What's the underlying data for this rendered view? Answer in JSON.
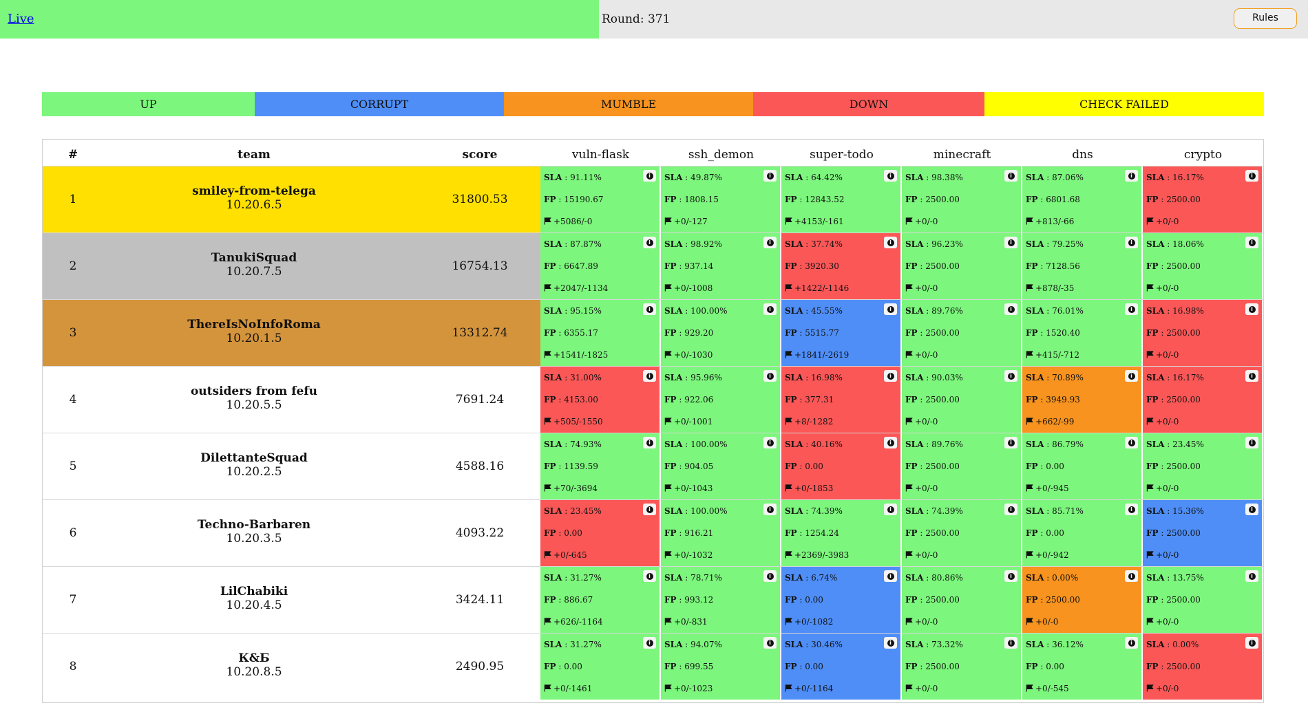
{
  "header": {
    "live_label": "Live",
    "round_label": "Round: 371",
    "rules_label": "Rules"
  },
  "colors": {
    "up": "#7cf67c",
    "corrupt": "#4f8ef7",
    "mumble": "#f7931e",
    "down": "#fb5757",
    "check_failed": "#ffff00",
    "gold": "#ffe000",
    "silver": "#c0c0c0",
    "bronze": "#d4943c"
  },
  "legend": [
    {
      "label": "UP",
      "status": "up"
    },
    {
      "label": "CORRUPT",
      "status": "corrupt"
    },
    {
      "label": "MUMBLE",
      "status": "mumble"
    },
    {
      "label": "DOWN",
      "status": "down"
    },
    {
      "label": "CHECK FAILED",
      "status": "check_failed"
    }
  ],
  "table": {
    "columns": {
      "rank": "#",
      "team": "team",
      "score": "score"
    },
    "services": [
      "vuln-flask",
      "ssh_demon",
      "super-todo",
      "minecraft",
      "dns",
      "crypto"
    ],
    "rows": [
      {
        "rank": "1",
        "name": "smiley-from-telega",
        "ip": "10.20.6.5",
        "score": "31800.53",
        "highlight": "gold",
        "cells": [
          {
            "status": "up",
            "sla": "91.11%",
            "fp": "15190.67",
            "flags": "+5086/-0"
          },
          {
            "status": "up",
            "sla": "49.87%",
            "fp": "1808.15",
            "flags": "+0/-127"
          },
          {
            "status": "up",
            "sla": "64.42%",
            "fp": "12843.52",
            "flags": "+4153/-161"
          },
          {
            "status": "up",
            "sla": "98.38%",
            "fp": "2500.00",
            "flags": "+0/-0"
          },
          {
            "status": "up",
            "sla": "87.06%",
            "fp": "6801.68",
            "flags": "+813/-66"
          },
          {
            "status": "down",
            "sla": "16.17%",
            "fp": "2500.00",
            "flags": "+0/-0"
          }
        ]
      },
      {
        "rank": "2",
        "name": "TanukiSquad",
        "ip": "10.20.7.5",
        "score": "16754.13",
        "highlight": "silver",
        "cells": [
          {
            "status": "up",
            "sla": "87.87%",
            "fp": "6647.89",
            "flags": "+2047/-1134"
          },
          {
            "status": "up",
            "sla": "98.92%",
            "fp": "937.14",
            "flags": "+0/-1008"
          },
          {
            "status": "down",
            "sla": "37.74%",
            "fp": "3920.30",
            "flags": "+1422/-1146"
          },
          {
            "status": "up",
            "sla": "96.23%",
            "fp": "2500.00",
            "flags": "+0/-0"
          },
          {
            "status": "up",
            "sla": "79.25%",
            "fp": "7128.56",
            "flags": "+878/-35"
          },
          {
            "status": "up",
            "sla": "18.06%",
            "fp": "2500.00",
            "flags": "+0/-0"
          }
        ]
      },
      {
        "rank": "3",
        "name": "ThereIsNoInfoRoma",
        "ip": "10.20.1.5",
        "score": "13312.74",
        "highlight": "bronze",
        "cells": [
          {
            "status": "up",
            "sla": "95.15%",
            "fp": "6355.17",
            "flags": "+1541/-1825"
          },
          {
            "status": "up",
            "sla": "100.00%",
            "fp": "929.20",
            "flags": "+0/-1030"
          },
          {
            "status": "corrupt",
            "sla": "45.55%",
            "fp": "5515.77",
            "flags": "+1841/-2619"
          },
          {
            "status": "up",
            "sla": "89.76%",
            "fp": "2500.00",
            "flags": "+0/-0"
          },
          {
            "status": "up",
            "sla": "76.01%",
            "fp": "1520.40",
            "flags": "+415/-712"
          },
          {
            "status": "down",
            "sla": "16.98%",
            "fp": "2500.00",
            "flags": "+0/-0"
          }
        ]
      },
      {
        "rank": "4",
        "name": "outsiders from fefu",
        "ip": "10.20.5.5",
        "score": "7691.24",
        "highlight": "none",
        "cells": [
          {
            "status": "down",
            "sla": "31.00%",
            "fp": "4153.00",
            "flags": "+505/-1550"
          },
          {
            "status": "up",
            "sla": "95.96%",
            "fp": "922.06",
            "flags": "+0/-1001"
          },
          {
            "status": "down",
            "sla": "16.98%",
            "fp": "377.31",
            "flags": "+8/-1282"
          },
          {
            "status": "up",
            "sla": "90.03%",
            "fp": "2500.00",
            "flags": "+0/-0"
          },
          {
            "status": "mumble",
            "sla": "70.89%",
            "fp": "3949.93",
            "flags": "+662/-99"
          },
          {
            "status": "down",
            "sla": "16.17%",
            "fp": "2500.00",
            "flags": "+0/-0"
          }
        ]
      },
      {
        "rank": "5",
        "name": "DilettanteSquad",
        "ip": "10.20.2.5",
        "score": "4588.16",
        "highlight": "none",
        "cells": [
          {
            "status": "up",
            "sla": "74.93%",
            "fp": "1139.59",
            "flags": "+70/-3694"
          },
          {
            "status": "up",
            "sla": "100.00%",
            "fp": "904.05",
            "flags": "+0/-1043"
          },
          {
            "status": "down",
            "sla": "40.16%",
            "fp": "0.00",
            "flags": "+0/-1853"
          },
          {
            "status": "up",
            "sla": "89.76%",
            "fp": "2500.00",
            "flags": "+0/-0"
          },
          {
            "status": "up",
            "sla": "86.79%",
            "fp": "0.00",
            "flags": "+0/-945"
          },
          {
            "status": "up",
            "sla": "23.45%",
            "fp": "2500.00",
            "flags": "+0/-0"
          }
        ]
      },
      {
        "rank": "6",
        "name": "Techno-Barbaren",
        "ip": "10.20.3.5",
        "score": "4093.22",
        "highlight": "none",
        "cells": [
          {
            "status": "down",
            "sla": "23.45%",
            "fp": "0.00",
            "flags": "+0/-645"
          },
          {
            "status": "up",
            "sla": "100.00%",
            "fp": "916.21",
            "flags": "+0/-1032"
          },
          {
            "status": "up",
            "sla": "74.39%",
            "fp": "1254.24",
            "flags": "+2369/-3983"
          },
          {
            "status": "up",
            "sla": "74.39%",
            "fp": "2500.00",
            "flags": "+0/-0"
          },
          {
            "status": "up",
            "sla": "85.71%",
            "fp": "0.00",
            "flags": "+0/-942"
          },
          {
            "status": "corrupt",
            "sla": "15.36%",
            "fp": "2500.00",
            "flags": "+0/-0"
          }
        ]
      },
      {
        "rank": "7",
        "name": "LilChabiki",
        "ip": "10.20.4.5",
        "score": "3424.11",
        "highlight": "none",
        "cells": [
          {
            "status": "up",
            "sla": "31.27%",
            "fp": "886.67",
            "flags": "+626/-1164"
          },
          {
            "status": "up",
            "sla": "78.71%",
            "fp": "993.12",
            "flags": "+0/-831"
          },
          {
            "status": "corrupt",
            "sla": "6.74%",
            "fp": "0.00",
            "flags": "+0/-1082"
          },
          {
            "status": "up",
            "sla": "80.86%",
            "fp": "2500.00",
            "flags": "+0/-0"
          },
          {
            "status": "mumble",
            "sla": "0.00%",
            "fp": "2500.00",
            "flags": "+0/-0"
          },
          {
            "status": "up",
            "sla": "13.75%",
            "fp": "2500.00",
            "flags": "+0/-0"
          }
        ]
      },
      {
        "rank": "8",
        "name": "К&Б",
        "ip": "10.20.8.5",
        "score": "2490.95",
        "highlight": "none",
        "cells": [
          {
            "status": "up",
            "sla": "31.27%",
            "fp": "0.00",
            "flags": "+0/-1461"
          },
          {
            "status": "up",
            "sla": "94.07%",
            "fp": "699.55",
            "flags": "+0/-1023"
          },
          {
            "status": "corrupt",
            "sla": "30.46%",
            "fp": "0.00",
            "flags": "+0/-1164"
          },
          {
            "status": "up",
            "sla": "73.32%",
            "fp": "2500.00",
            "flags": "+0/-0"
          },
          {
            "status": "up",
            "sla": "36.12%",
            "fp": "0.00",
            "flags": "+0/-545"
          },
          {
            "status": "down",
            "sla": "0.00%",
            "fp": "2500.00",
            "flags": "+0/-0"
          }
        ]
      }
    ]
  },
  "labels": {
    "sla": "SLA",
    "fp": "FP"
  },
  "icons": {
    "info": "info-icon",
    "flag": "flag-icon"
  }
}
